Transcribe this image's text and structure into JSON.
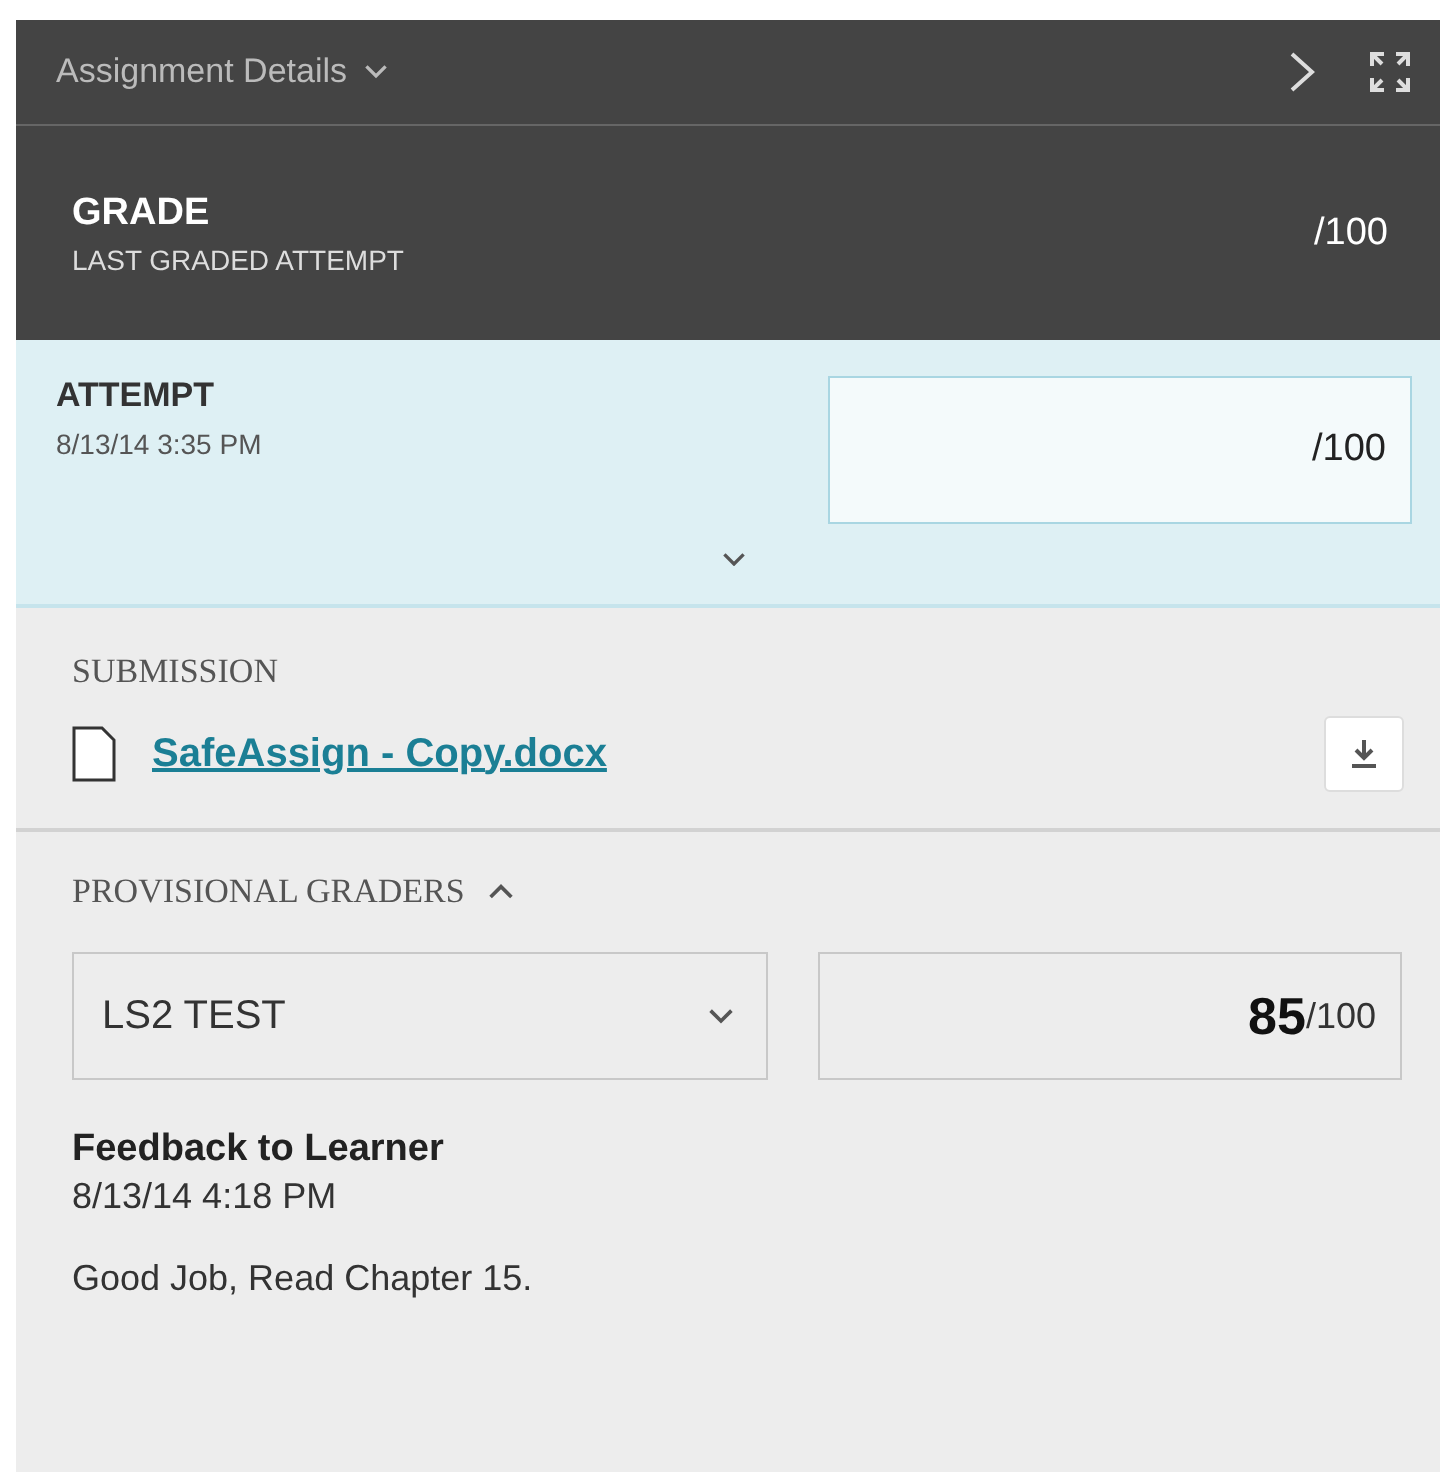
{
  "header": {
    "title": "Assignment Details"
  },
  "grade": {
    "title": "GRADE",
    "subtitle": "LAST GRADED ATTEMPT",
    "value": "/100"
  },
  "attempt": {
    "title": "ATTEMPT",
    "date": "8/13/14 3:35 PM",
    "value": "/100",
    "expanded": false
  },
  "submission": {
    "heading": "SUBMISSION",
    "file": "SafeAssign - Copy.docx"
  },
  "provisional_graders": {
    "heading": "PROVISIONAL GRADERS",
    "expanded": true,
    "grader": "LS2 TEST",
    "score": "85",
    "out_of": "/100",
    "feedback_title": "Feedback to Learner",
    "feedback_date": "8/13/14 4:18 PM",
    "feedback": "Good Job, Read Chapter 15."
  }
}
